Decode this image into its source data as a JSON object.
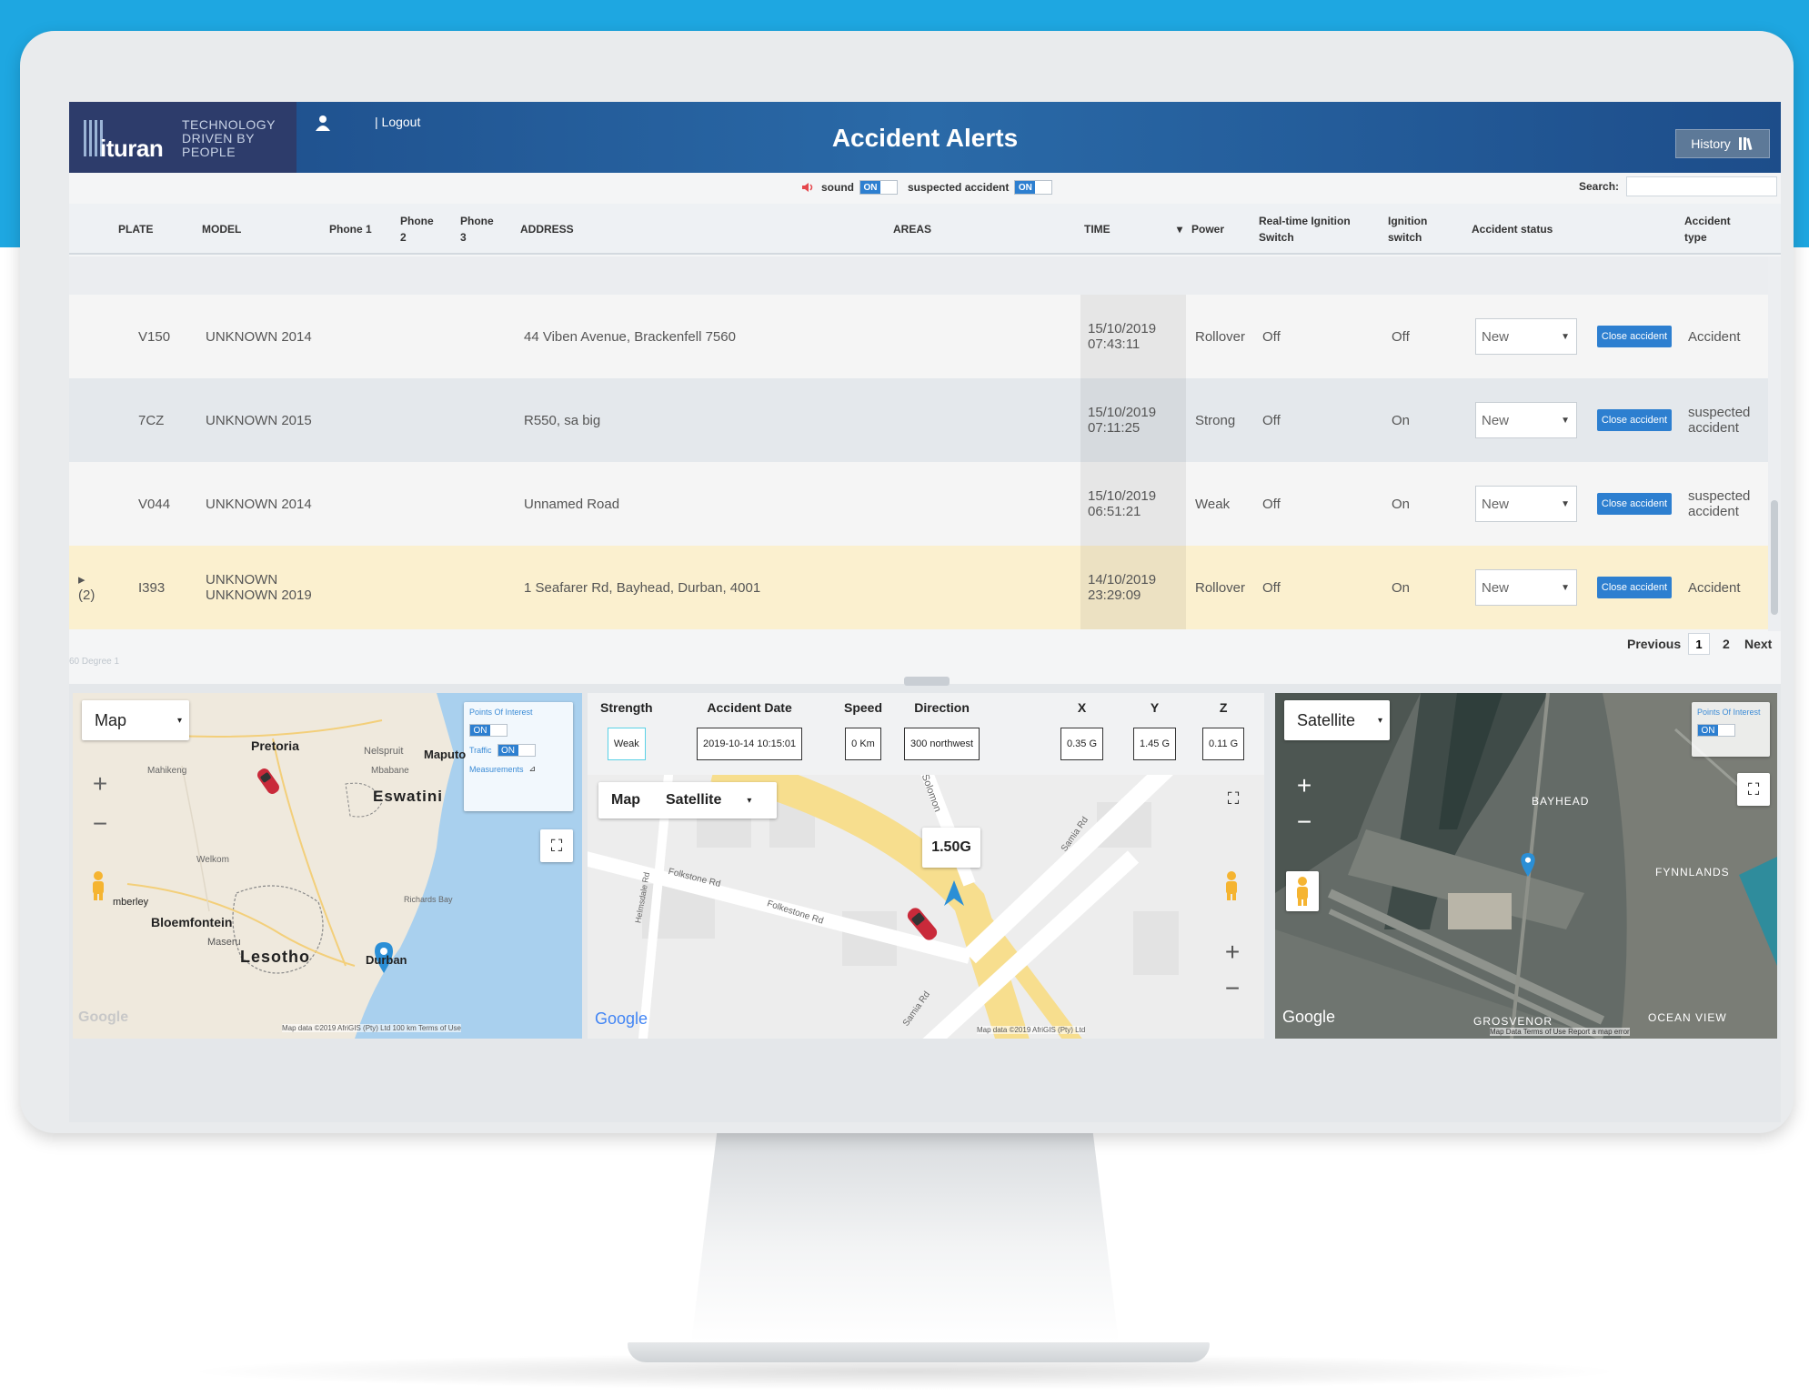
{
  "app": {
    "logo_word": "ituran",
    "logo_tagline": "TECHNOLOGY DRIVEN BY PEOPLE",
    "logout_label": "| Logout",
    "title": "Accident Alerts",
    "history_label": "History"
  },
  "toolbar": {
    "sound_label": "sound",
    "sound_state": "ON",
    "suspected_label": "suspected accident",
    "suspected_state": "ON",
    "search_label": "Search:",
    "search_value": ""
  },
  "table": {
    "headers": {
      "plate": "PLATE",
      "model": "MODEL",
      "phone1": "Phone 1",
      "phone2": "Phone 2",
      "phone3": "Phone 3",
      "address": "ADDRESS",
      "areas": "AREAS",
      "time": "TIME",
      "power": "Power",
      "rt_ignition": "Real-time Ignition Switch",
      "ignition": "Ignition switch",
      "status": "Accident status",
      "type": "Accident type"
    },
    "rows": [
      {
        "expand": "",
        "plate": "V150",
        "model": "UNKNOWN 2014",
        "address": "44 Viben Avenue, Brackenfell 7560",
        "time": "15/10/2019 07:43:11",
        "power": "Rollover",
        "rt_ignition": "Off",
        "ignition": "Off",
        "status": "New",
        "close": "Close accident",
        "type": "Accident"
      },
      {
        "expand": "",
        "plate": "7CZ",
        "model": "UNKNOWN 2015",
        "address": "R550, sa big",
        "time": "15/10/2019 07:11:25",
        "power": "Strong",
        "rt_ignition": "Off",
        "ignition": "On",
        "status": "New",
        "close": "Close accident",
        "type": "suspected accident"
      },
      {
        "expand": "",
        "plate": "V044",
        "model": "UNKNOWN 2014",
        "address": "Unnamed Road",
        "time": "15/10/2019 06:51:21",
        "power": "Weak",
        "rt_ignition": "Off",
        "ignition": "On",
        "status": "New",
        "close": "Close accident",
        "type": "suspected accident"
      },
      {
        "expand": "▸ (2)",
        "plate": "I393",
        "model": "UNKNOWN UNKNOWN 2019",
        "address": "1 Seafarer Rd, Bayhead, Durban, 4001",
        "time": "14/10/2019 23:29:09",
        "power": "Rollover",
        "rt_ignition": "Off",
        "ignition": "On",
        "status": "New",
        "close": "Close accident",
        "type": "Accident"
      }
    ],
    "row_colors": [
      "#f5f5f5",
      "#e4e8ec",
      "#f5f5f5",
      "#fbf0cf"
    ]
  },
  "pagination": {
    "previous": "Previous",
    "pages": [
      "1",
      "2"
    ],
    "next": "Next",
    "faint_text": "60 Degree 1"
  },
  "map1": {
    "type_label": "Map",
    "poi_label": "Points Of Interest",
    "poi_state": "ON",
    "traffic_label": "Traffic",
    "traffic_state": "ON",
    "measurements_label": "Measurements",
    "places": {
      "pretoria": "Pretoria",
      "mahikeng": "Mahikeng",
      "nelspruit": "Nelspruit",
      "maputo": "Maputo",
      "mbabane": "Mbabane",
      "eswatini": "Eswatini",
      "welkom": "Welkom",
      "kimberley": "mberley",
      "bloemfontein": "Bloemfontein",
      "maseru": "Maseru",
      "lesotho": "Lesotho",
      "durban": "Durban",
      "richards_bay": "Richards Bay"
    },
    "attribution": "Map data ©2019 AfriGIS (Pty) Ltd   100 km   Terms of Use",
    "google": "Google"
  },
  "details": {
    "labels": [
      "Strength",
      "Accident Date",
      "Speed",
      "Direction",
      "X",
      "Y",
      "Z"
    ],
    "values": [
      "Weak",
      "2019-10-14 10:15:01",
      "0 Km",
      "300 northwest",
      "0.35 G",
      "1.45 G",
      "0.11 G"
    ],
    "map_label": "Map",
    "satellite_label": "Satellite",
    "g_force": "1.50G",
    "streets": {
      "folkstone1": "Folkstone Rd",
      "folkstone2": "Folkestone Rd",
      "solomon": "Solomon",
      "samia1": "Samia Rd",
      "samia2": "Samia Rd",
      "helmsdale": "Helmsdale Rd"
    },
    "attribution": "Map data ©2019 AfriGIS (Pty) Ltd",
    "google": "Google"
  },
  "map3": {
    "type_label": "Satellite",
    "poi_label": "Points Of Interest",
    "poi_state": "ON",
    "places": {
      "bayhead": "BAYHEAD",
      "fynnlands": "FYNNLANDS",
      "grosvenor": "GROSVENOR",
      "ocean_view": "OCEAN VIEW"
    },
    "attribution": "Map Data   Terms of Use   Report a map error",
    "google": "Google"
  },
  "colors": {
    "brand_blue": "#1ea7e1",
    "header_dark": "#2d3c6b",
    "button_blue": "#2d7fd0",
    "highlight_row": "#fbf0cf"
  }
}
